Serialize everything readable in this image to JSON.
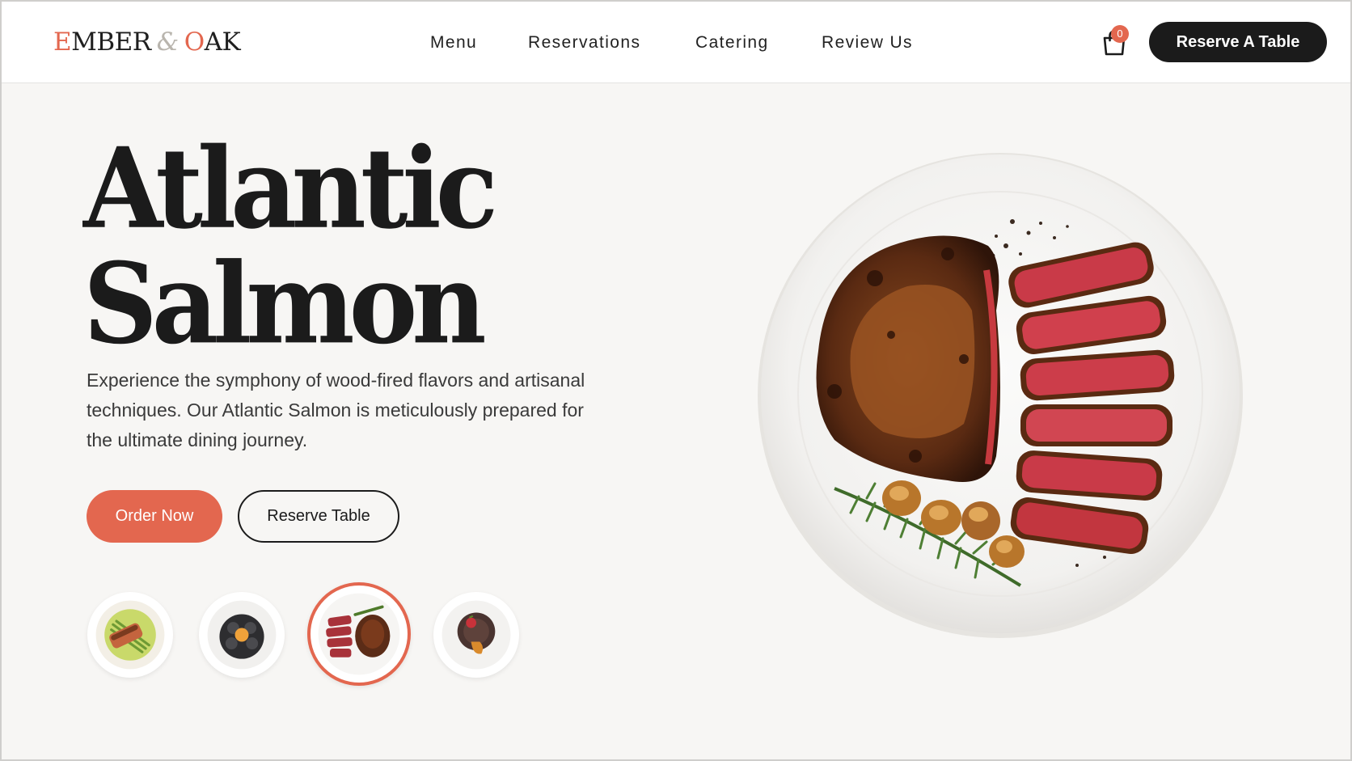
{
  "brand": {
    "logo_first_letter": "E",
    "logo_word1_rest": "MBER",
    "logo_amp": "&",
    "logo_second_letter": "O",
    "logo_word2_rest": "AK"
  },
  "nav": {
    "items": [
      "Menu",
      "Reservations",
      "Catering",
      "Review Us"
    ]
  },
  "cart": {
    "icon": "shopping-bag-icon",
    "count": "0"
  },
  "header_cta": {
    "label": "Reserve A Table"
  },
  "hero": {
    "title_line1": "Atlantic",
    "title_line2": "Salmon",
    "description": "Experience the symphony of wood-fired flavors and artisanal techniques. Our Atlantic Salmon is meticulously prepared for the ultimate dining journey.",
    "primary_button": "Order Now",
    "secondary_button": "Reserve Table"
  },
  "dish_thumbnails": {
    "selected_index": 2,
    "items": [
      "salmon-dish-thumb",
      "scallop-dish-thumb",
      "steak-dish-thumb",
      "dessert-dish-thumb"
    ]
  },
  "colors": {
    "accent": "#e3674f",
    "dark": "#1b1b1b",
    "background": "#f7f6f4",
    "header_bg": "#ffffff"
  }
}
